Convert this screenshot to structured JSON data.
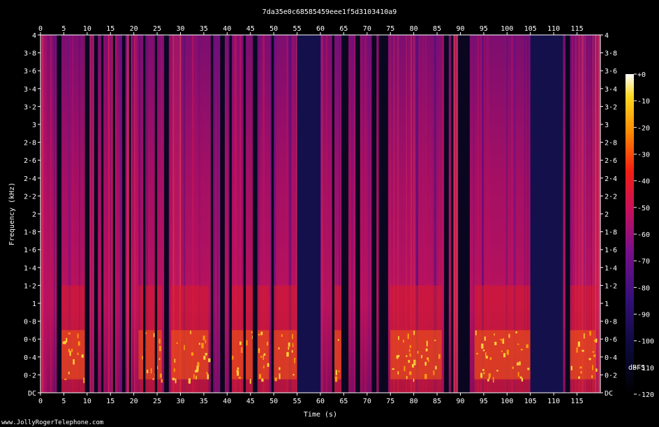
{
  "chart_data": {
    "type": "heatmap",
    "title": "7da35e0c68585459eee1f5d3103410a9",
    "xlabel": "Time (s)",
    "ylabel": "Frequency (kHz)",
    "xlim": [
      0,
      120
    ],
    "ylim": [
      0,
      4
    ],
    "x_ticks": [
      "0",
      "5",
      "10",
      "15",
      "20",
      "25",
      "30",
      "35",
      "40",
      "45",
      "50",
      "55",
      "60",
      "65",
      "70",
      "75",
      "80",
      "85",
      "90",
      "95",
      "100",
      "105",
      "110",
      "115"
    ],
    "x_tick_values": [
      0,
      5,
      10,
      15,
      20,
      25,
      30,
      35,
      40,
      45,
      50,
      55,
      60,
      65,
      70,
      75,
      80,
      85,
      90,
      95,
      100,
      105,
      110,
      115
    ],
    "y_ticks": [
      "DC",
      "0·2",
      "0·4",
      "0·6",
      "0·8",
      "1",
      "1·2",
      "1·4",
      "1·6",
      "1·8",
      "2",
      "2·2",
      "2·4",
      "2·6",
      "2·8",
      "3",
      "3·2",
      "3·4",
      "3·6",
      "3·8",
      "4"
    ],
    "y_tick_values": [
      0,
      0.2,
      0.4,
      0.6,
      0.8,
      1.0,
      1.2,
      1.4,
      1.6,
      1.8,
      2.0,
      2.2,
      2.4,
      2.6,
      2.8,
      3.0,
      3.2,
      3.4,
      3.6,
      3.8,
      4.0
    ],
    "colorbar": {
      "label": "dBFS",
      "ticks": [
        "+0",
        "-10",
        "-20",
        "-30",
        "-40",
        "-50",
        "-60",
        "-70",
        "-80",
        "-90",
        "-100",
        "-110",
        "-120"
      ],
      "tick_values": [
        0,
        -10,
        -20,
        -30,
        -40,
        -50,
        -60,
        -70,
        -80,
        -90,
        -100,
        -110,
        -120
      ],
      "range": [
        -120,
        0
      ]
    },
    "silent_intervals": [
      [
        3.5,
        4.5
      ],
      [
        9.5,
        10.5
      ],
      [
        11.5,
        12.3
      ],
      [
        13,
        13.5
      ],
      [
        15.5,
        16
      ],
      [
        17.5,
        18.2
      ],
      [
        19,
        19.4
      ],
      [
        22,
        22.5
      ],
      [
        24.5,
        25
      ],
      [
        26.5,
        27.5
      ],
      [
        36.5,
        37
      ],
      [
        38.5,
        39.5
      ],
      [
        40.5,
        41
      ],
      [
        43.5,
        44
      ],
      [
        45.5,
        46.5
      ],
      [
        49.5,
        50
      ],
      [
        55,
        60
      ],
      [
        62.5,
        63
      ],
      [
        64.5,
        66
      ],
      [
        67.5,
        68.5
      ],
      [
        71,
        72
      ],
      [
        72.5,
        74.5
      ],
      [
        86.5,
        87.5
      ],
      [
        88,
        88.5
      ],
      [
        89.5,
        92
      ],
      [
        105,
        112
      ],
      [
        112.5,
        113.5
      ]
    ],
    "loud_low_regions": [
      [
        4.5,
        9.5
      ],
      [
        21,
        26
      ],
      [
        28,
        36
      ],
      [
        41,
        49
      ],
      [
        50,
        55
      ],
      [
        63,
        64.5
      ],
      [
        75,
        86
      ],
      [
        93,
        105
      ],
      [
        113.5,
        119
      ]
    ]
  },
  "credit": "www.JollyRogerTelephone.com"
}
